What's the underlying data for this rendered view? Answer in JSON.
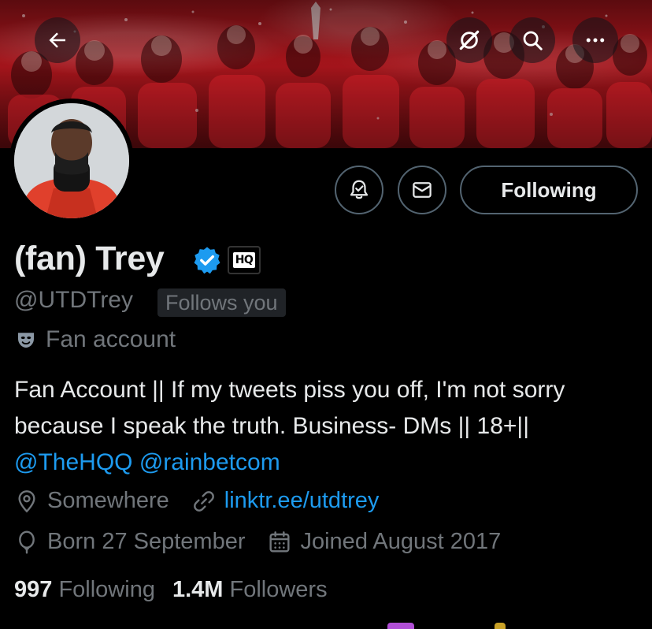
{
  "profile": {
    "display_name": "(fan) Trey",
    "handle": "@UTDTrey",
    "follows_you": "Follows you",
    "label": "Fan account",
    "affiliate_badge": "HQ",
    "bio": {
      "line1": "Fan Account || If my tweets piss you off, I'm not sorry",
      "line2": "because I speak the truth. Business- DMs || 18+||",
      "mention1": "@TheHQQ",
      "mention2": "@rainbetcom"
    },
    "location": "Somewhere",
    "website": "linktr.ee/utdtrey",
    "birthday": "Born 27 September",
    "joined": "Joined August 2017",
    "following_count": "997",
    "following_label": "Following",
    "followers_count": "1.4M",
    "followers_label": "Followers"
  },
  "actions": {
    "following_button": "Following"
  },
  "icons": {
    "back": "back-arrow-icon",
    "grok": "grok-icon",
    "search": "search-icon",
    "more": "more-icon",
    "notify": "notification-bell-icon",
    "message": "envelope-icon",
    "verified": "verified-badge-icon",
    "label": "theater-mask-icon",
    "location": "location-pin-icon",
    "link": "link-icon",
    "birthday": "balloon-icon",
    "joined": "calendar-icon"
  },
  "colors": {
    "background": "#000000",
    "text_primary": "#e7e9ea",
    "text_secondary": "#71767b",
    "link": "#1d9bf0",
    "border": "#536471",
    "banner_red": "#b0161d"
  }
}
